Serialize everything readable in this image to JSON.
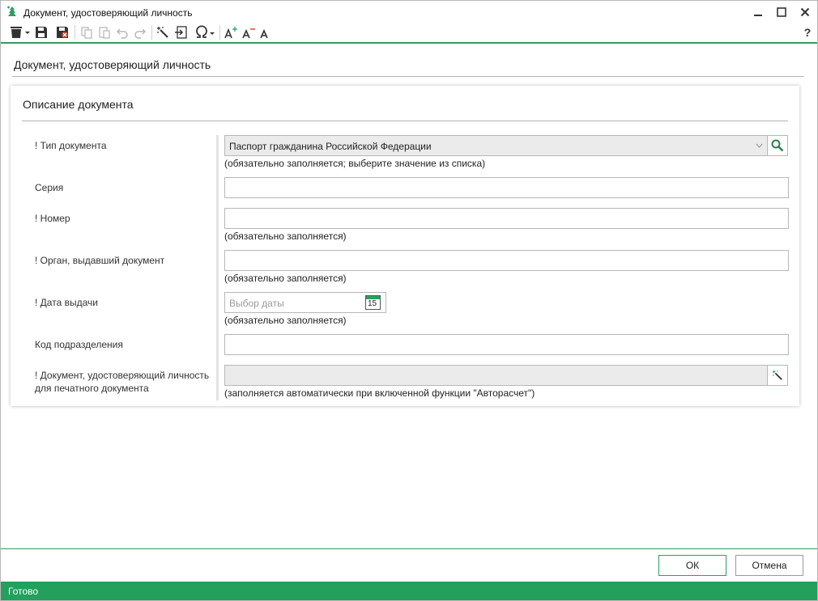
{
  "window": {
    "title": "Документ, удостоверяющий личность",
    "minimize_icon": "minimize-icon",
    "maximize_icon": "maximize-icon",
    "close_icon": "close-icon"
  },
  "toolbar": {
    "icons": [
      "delete-icon",
      "save-icon",
      "save-close-icon",
      "copy-icon",
      "paste-icon",
      "undo-icon",
      "redo-icon",
      "magic-wand-icon",
      "import-icon",
      "omega-icon",
      "font-increase-icon",
      "font-decrease-icon",
      "font-normal-icon",
      "help-icon"
    ],
    "help_label": "?"
  },
  "page": {
    "title": "Документ, удостоверяющий личность"
  },
  "section": {
    "title": "Описание документа",
    "fields": {
      "doc_type": {
        "label": "! Тип документа",
        "value": "Паспорт гражданина Российской Федерации",
        "hint": "(обязательно заполняется; выберите значение из списка)"
      },
      "series": {
        "label": "Серия",
        "value": ""
      },
      "number": {
        "label": "! Номер",
        "value": "",
        "hint": "(обязательно заполняется)"
      },
      "issuer": {
        "label": "! Орган, выдавший документ",
        "value": "",
        "hint": "(обязательно заполняется)"
      },
      "issue_date": {
        "label": "! Дата выдачи",
        "placeholder": "Выбор даты",
        "calendar_day": "15",
        "hint": "(обязательно заполняется)"
      },
      "division_code": {
        "label": "Код подразделения",
        "value": ""
      },
      "print_doc": {
        "label_line1": "! Документ, удостоверяющий личность",
        "label_line2": "для печатного документа",
        "value": "",
        "hint": "(заполняется автоматически при включенной функции \"Авторасчет\")"
      }
    }
  },
  "buttons": {
    "ok": "ОК",
    "cancel": "Отмена"
  },
  "status": {
    "text": "Готово"
  },
  "colors": {
    "accent": "#2e9d62",
    "status_bar": "#22a05c"
  }
}
